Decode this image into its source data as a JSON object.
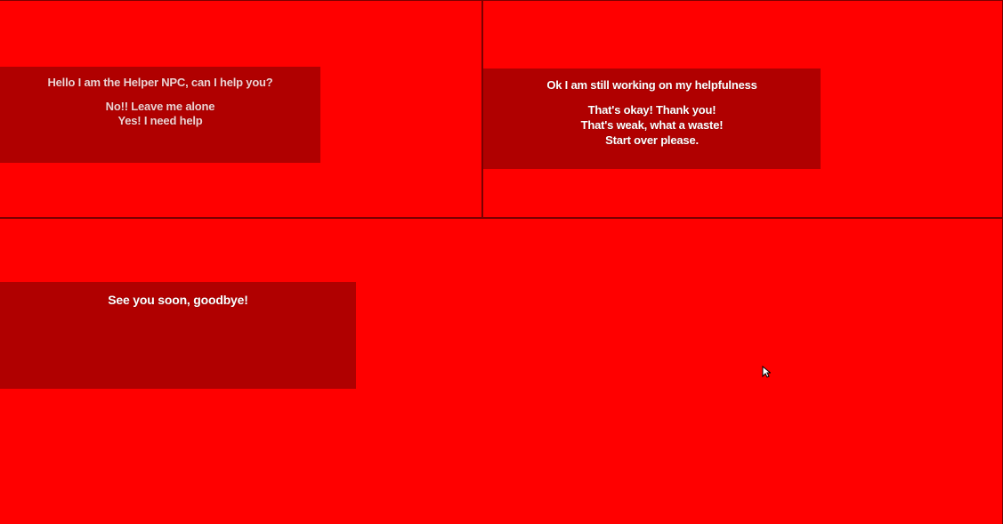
{
  "dialog_1": {
    "prompt": "Hello I am the Helper NPC, can I help you?",
    "options": [
      "No!! Leave me alone",
      "Yes! I need help"
    ]
  },
  "dialog_2": {
    "prompt": "Ok I am still working on my helpfulness",
    "options": [
      "That's okay! Thank you!",
      "That's weak, what a waste!",
      "Start over please."
    ]
  },
  "dialog_3": {
    "prompt": "See you soon, goodbye!"
  },
  "colors": {
    "background": "#ff0000",
    "panel": "#b00000",
    "divider": "#7a0000",
    "text": "#ffffff"
  },
  "icons": {
    "cursor": "mouse-pointer-icon"
  }
}
